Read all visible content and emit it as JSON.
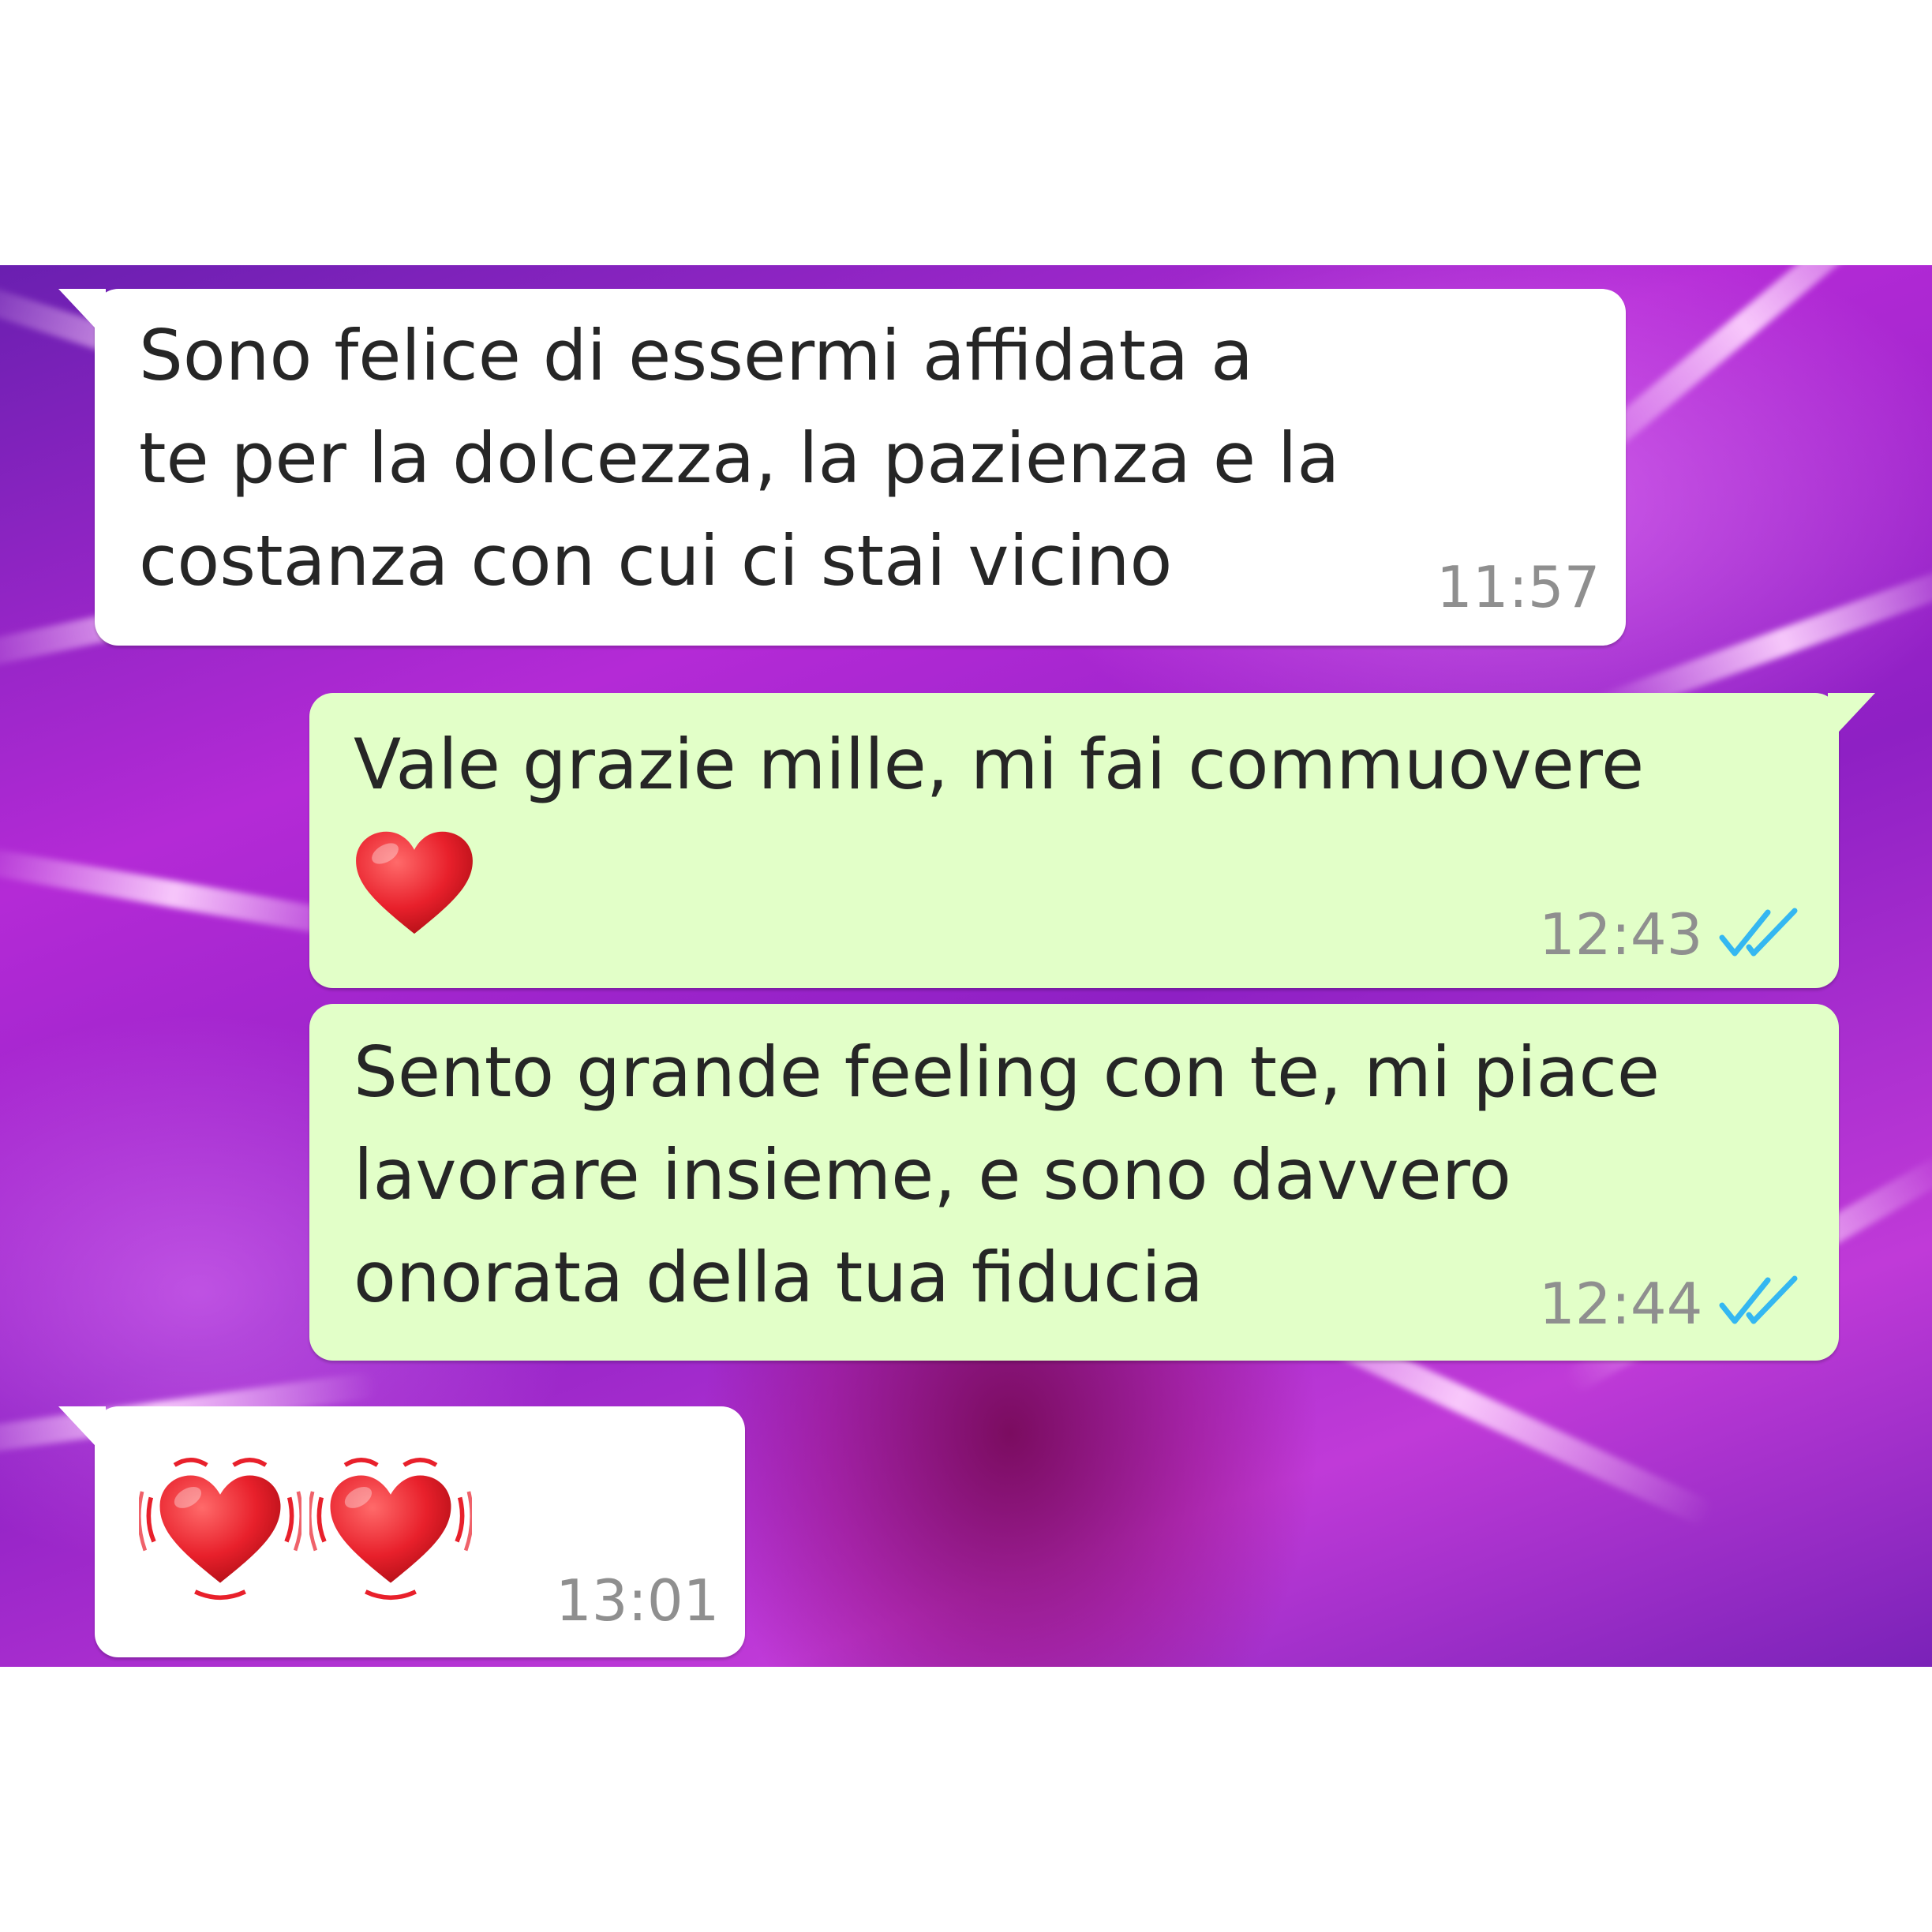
{
  "messages": [
    {
      "direction": "incoming",
      "text": "Sono felice di essermi affidata a\nte per la dolcezza, la pazienza e la\ncostanza con cui ci stai vicino",
      "time": "11:57"
    },
    {
      "direction": "outgoing",
      "text": "Vale grazie mille, mi fai commuovere",
      "emoji": "red-heart",
      "time": "12:43",
      "status": "read"
    },
    {
      "direction": "outgoing",
      "text": "Sento grande feeling con te, mi piace\nlavorare insieme, e sono davvero\nonorata della tua fiducia",
      "time": "12:44",
      "status": "read"
    },
    {
      "direction": "incoming",
      "emoji": "beating-heart x2",
      "time": "13:01"
    }
  ],
  "colors": {
    "incoming_bubble": "#ffffff",
    "outgoing_bubble": "#e2ffc8",
    "read_tick": "#34b7f1",
    "heart": "#e8202b",
    "timestamp": "#8f8f8f"
  }
}
